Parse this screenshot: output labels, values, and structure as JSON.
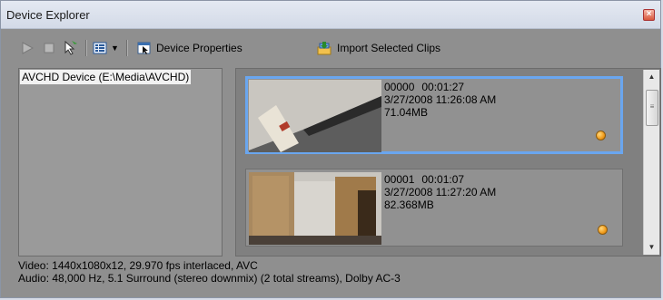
{
  "window": {
    "title": "Device Explorer"
  },
  "toolbar": {
    "device_properties_label": "Device Properties",
    "import_selected_label": "Import Selected Clips"
  },
  "devices": [
    {
      "label": "AVCHD Device (E:\\Media\\AVCHD)"
    }
  ],
  "clips": [
    {
      "id": "00000",
      "duration": "00:01:27",
      "datetime": "3/27/2008 11:26:08 AM",
      "size": "71.04MB"
    },
    {
      "id": "00001",
      "duration": "00:01:07",
      "datetime": "3/27/2008 11:27:20 AM",
      "size": "82.368MB"
    }
  ],
  "status": {
    "video": "Video: 1440x1080x12, 29.970 fps interlaced, AVC",
    "audio": "Audio: 48,000 Hz, 5.1 Surround (stereo downmix) (2 total streams), Dolby AC-3"
  },
  "colors": {
    "selection": "#6aa6ef",
    "badge": "#f09a1a"
  }
}
